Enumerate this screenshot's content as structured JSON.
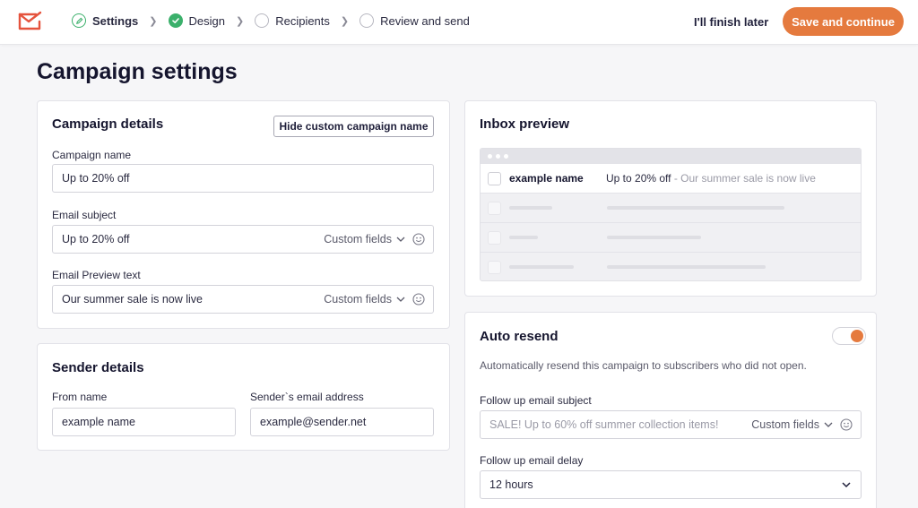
{
  "header": {
    "steps": [
      {
        "label": "Settings",
        "state": "current"
      },
      {
        "label": "Design",
        "state": "done"
      },
      {
        "label": "Recipients",
        "state": "todo"
      },
      {
        "label": "Review and send",
        "state": "todo"
      }
    ],
    "finish_later": "I'll finish later",
    "save_continue": "Save and continue"
  },
  "page": {
    "title": "Campaign settings"
  },
  "campaign_details": {
    "title": "Campaign details",
    "hide_button": "Hide custom campaign name",
    "campaign_name_label": "Campaign name",
    "campaign_name_value": "Up to 20% off",
    "email_subject_label": "Email subject",
    "email_subject_value": "Up to 20% off",
    "preview_text_label": "Email Preview text",
    "preview_text_value": "Our summer sale is now live",
    "custom_fields": "Custom fields"
  },
  "sender_details": {
    "title": "Sender details",
    "from_name_label": "From name",
    "from_name_value": "example name",
    "email_label": "Sender`s email address",
    "email_value": "example@sender.net"
  },
  "inbox_preview": {
    "title": "Inbox preview",
    "sender": "example name",
    "subject": "Up to 20% off",
    "preview": " - Our summer sale is now live"
  },
  "auto_resend": {
    "title": "Auto resend",
    "enabled": true,
    "description": "Automatically resend this campaign to subscribers who did not open.",
    "subject_label": "Follow up email subject",
    "subject_placeholder": "SALE! Up to 60% off summer collection items!",
    "custom_fields": "Custom fields",
    "delay_label": "Follow up email delay",
    "delay_value": "12 hours"
  },
  "colors": {
    "accent": "#e57a3e",
    "success": "#3bb06b"
  }
}
